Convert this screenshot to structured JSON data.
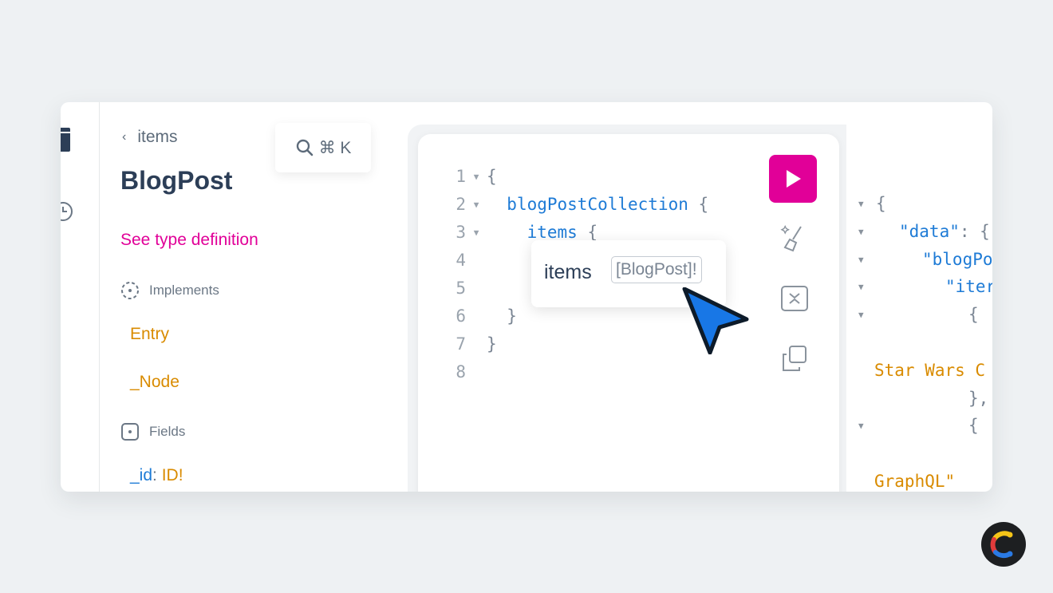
{
  "explorer": {
    "back_label": "items",
    "type_name": "BlogPost",
    "type_definition_link": "See type definition",
    "implements_label": "Implements",
    "interfaces": [
      "Entry",
      "_Node"
    ],
    "fields_label": "Fields",
    "field": {
      "name": "_id",
      "colon": ":",
      "type": "ID!"
    }
  },
  "search": {
    "shortcut": "⌘ K"
  },
  "editor": {
    "lines": [
      {
        "n": "1",
        "fold": "▼",
        "indent": "",
        "text": "{",
        "kw": false
      },
      {
        "n": "2",
        "fold": "▼",
        "indent": "  ",
        "text": "blogPostCollection",
        "suffix": " {",
        "kw": true
      },
      {
        "n": "3",
        "fold": "▼",
        "indent": "    ",
        "text": "items",
        "suffix": " {",
        "kw": true
      },
      {
        "n": "4",
        "fold": "",
        "indent": "",
        "text": "",
        "kw": false
      },
      {
        "n": "5",
        "fold": "",
        "indent": "",
        "text": "",
        "kw": false
      },
      {
        "n": "6",
        "fold": "",
        "indent": "  ",
        "text": "}",
        "kw": false
      },
      {
        "n": "7",
        "fold": "",
        "indent": "",
        "text": "}",
        "kw": false
      },
      {
        "n": "8",
        "fold": "",
        "indent": "",
        "text": "",
        "kw": false
      }
    ],
    "tooltip": {
      "name": "items",
      "type": "[BlogPost]!"
    }
  },
  "result": {
    "lines": [
      {
        "fold": "▼",
        "indent": 0,
        "parts": [
          {
            "c": "rpun",
            "t": "{"
          }
        ]
      },
      {
        "fold": "▼",
        "indent": 1,
        "parts": [
          {
            "c": "rkey",
            "t": "\"data\""
          },
          {
            "c": "rpun",
            "t": ": {"
          }
        ]
      },
      {
        "fold": "▼",
        "indent": 2,
        "parts": [
          {
            "c": "rkey",
            "t": "\"blogPo"
          }
        ]
      },
      {
        "fold": "▼",
        "indent": 3,
        "parts": [
          {
            "c": "rkey",
            "t": "\"iter"
          }
        ]
      },
      {
        "fold": "▼",
        "indent": 4,
        "parts": [
          {
            "c": "rpun",
            "t": "{"
          }
        ]
      },
      {
        "fold": "",
        "indent": 5,
        "parts": [
          {
            "c": "rkey",
            "t": "\""
          }
        ]
      },
      {
        "fold": "",
        "indent": 0,
        "parts": [
          {
            "c": "rstr",
            "t": "Star Wars C"
          }
        ]
      },
      {
        "fold": "",
        "indent": 4,
        "parts": [
          {
            "c": "rpun",
            "t": "},"
          }
        ]
      },
      {
        "fold": "▼",
        "indent": 4,
        "parts": [
          {
            "c": "rpun",
            "t": "{"
          }
        ]
      },
      {
        "fold": "",
        "indent": 5,
        "parts": [
          {
            "c": "rkey",
            "t": "\""
          }
        ]
      },
      {
        "fold": "",
        "indent": 0,
        "parts": [
          {
            "c": "rstr",
            "t": "GraphQL\""
          }
        ]
      }
    ]
  },
  "colors": {
    "accent": "#e10098",
    "keyword": "#1e7bd6",
    "string": "#d98b00",
    "cursor": "#1877e6"
  }
}
